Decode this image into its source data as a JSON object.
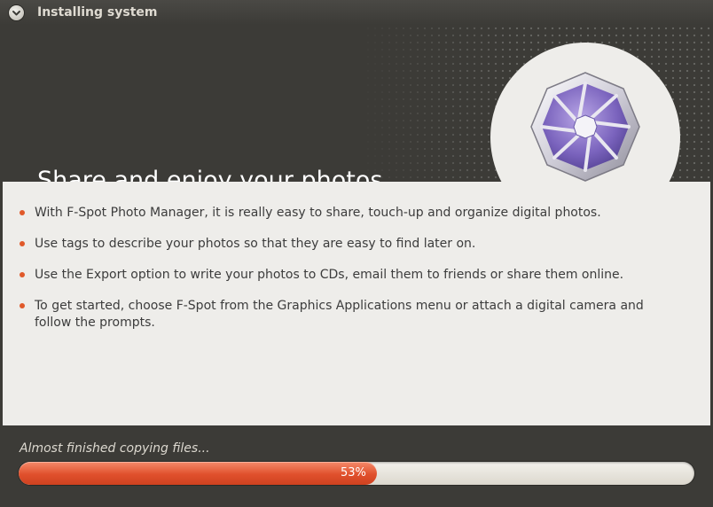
{
  "window": {
    "title": "Installing system",
    "menu_icon": "chevron-down-icon"
  },
  "banner": {
    "heading": "Share and enjoy your photos",
    "logo_icon": "f-spot-logo-icon"
  },
  "content": {
    "bullets": [
      "With F-Spot Photo Manager, it is really easy to share, touch-up and organize digital photos.",
      "Use tags to describe your photos so that they are easy to find later on.",
      "Use the Export option to write your photos to CDs, email them to friends or share them online.",
      "To get started, choose F-Spot from the Graphics Applications menu or attach a digital camera and follow the prompts."
    ]
  },
  "progress": {
    "status": "Almost finished copying files...",
    "value": 0.53,
    "label": "53%"
  },
  "colors": {
    "accent": "#e0502c",
    "bullet": "#e0592a",
    "dark_bg": "#3c3b37",
    "content_bg": "#eeedea"
  }
}
